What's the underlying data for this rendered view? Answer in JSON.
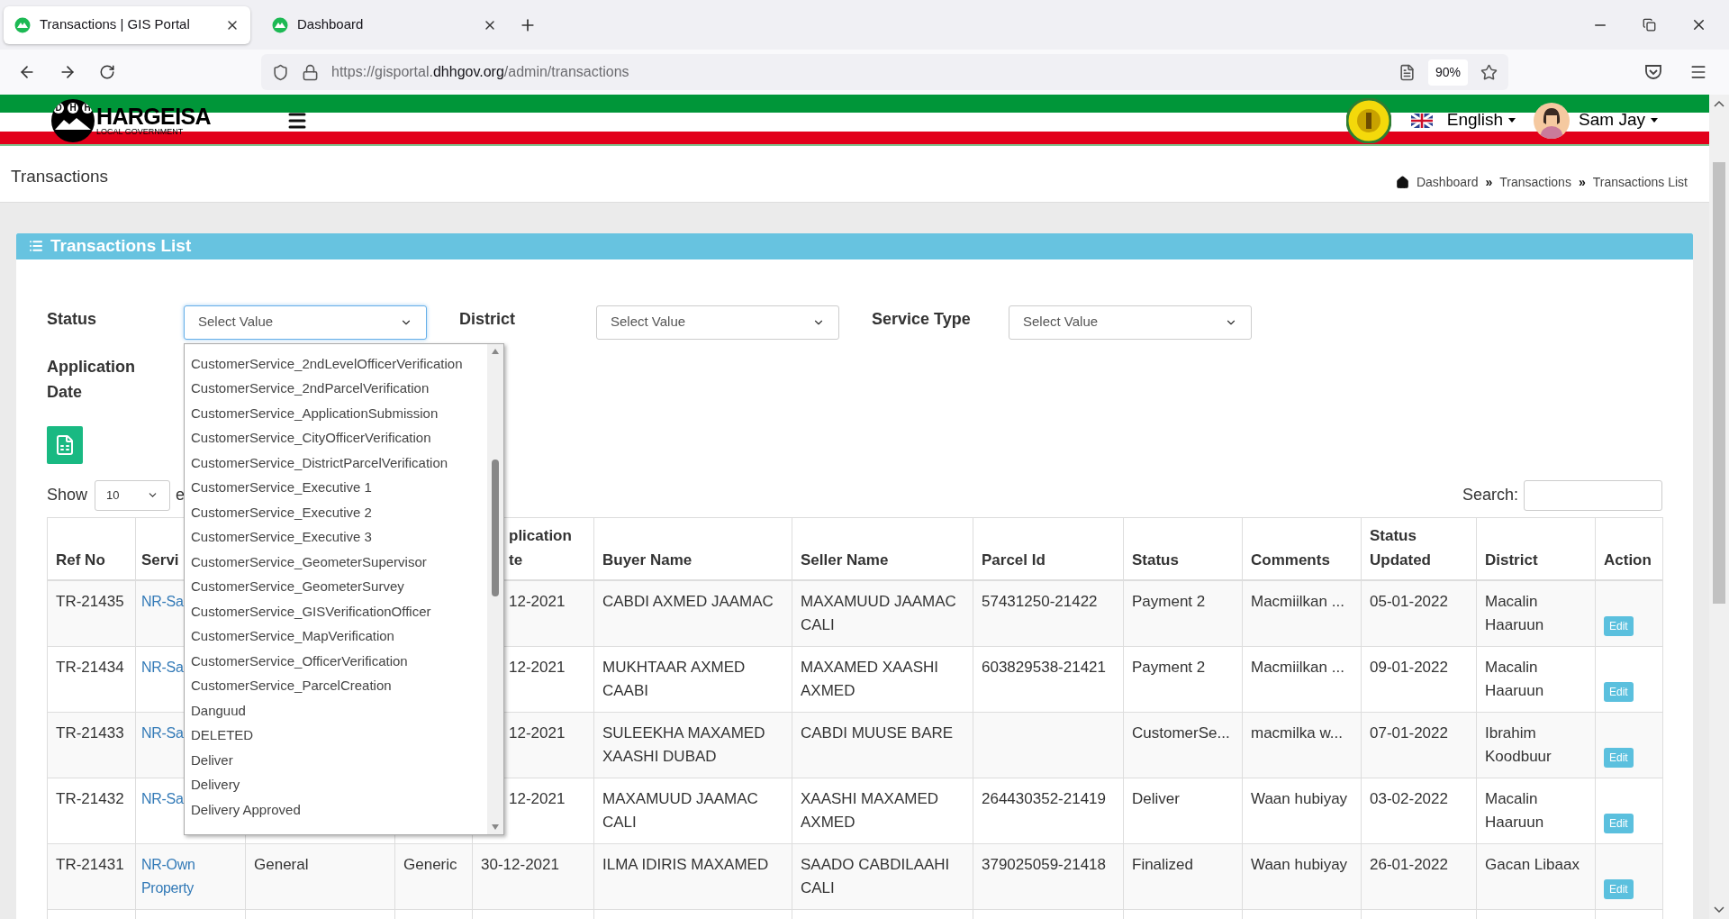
{
  "browser": {
    "tabs": [
      {
        "title": "Transactions | GIS Portal",
        "selected": true
      },
      {
        "title": "Dashboard",
        "selected": false
      }
    ],
    "url": {
      "prefix": "https://gisportal.",
      "domain": "dhhgov.org",
      "path": "/admin/transactions"
    },
    "zoom": "90%"
  },
  "header": {
    "logo": {
      "letters": [
        "D",
        "H",
        "H"
      ],
      "title": "HARGEISA",
      "subtitle": "LOCAL GOVERNMENT"
    },
    "language": "English",
    "user": "Sam Jay"
  },
  "page_title": "Transactions",
  "breadcrumb": {
    "items": [
      "Dashboard",
      "Transactions",
      "Transactions List"
    ],
    "separator": "»"
  },
  "card": {
    "title": "Transactions List",
    "filters": [
      {
        "label": "Status",
        "value": "Select Value",
        "open": true
      },
      {
        "label": "District",
        "value": "Select Value",
        "open": false
      },
      {
        "label": "Service Type",
        "value": "Select Value",
        "open": false
      }
    ],
    "status_options": [
      "CustomerService_2ndLevelOfficerVerification",
      "CustomerService_2ndParcelVerification",
      "CustomerService_ApplicationSubmission",
      "CustomerService_CityOfficerVerification",
      "CustomerService_DistrictParcelVerification",
      "CustomerService_Executive 1",
      "CustomerService_Executive 2",
      "CustomerService_Executive 3",
      "CustomerService_GeometerSupervisor",
      "CustomerService_GeometerSurvey",
      "CustomerService_GISVerificationOfficer",
      "CustomerService_MapVerification",
      "CustomerService_OfficerVerification",
      "CustomerService_ParcelCreation",
      "Danguud",
      "DELETED",
      "Deliver",
      "Delivery",
      "Delivery Approved"
    ],
    "date_filter_label": "Application Date",
    "length": {
      "label": "Show",
      "value": "10",
      "suffix": "e"
    },
    "search_label": "Search:",
    "table": {
      "columns_under_menu": true,
      "columns": {
        "ref_no": "Ref No",
        "service": "Servi",
        "application_date": [
          "plication",
          "te"
        ],
        "buyer_name": "Buyer Name",
        "seller_name": "Seller Name",
        "parcel_id": "Parcel Id",
        "status": "Status",
        "comments": "Comments",
        "status_updated": [
          "Status",
          "Updated"
        ],
        "district": "District",
        "action": "Action"
      },
      "rows": [
        {
          "under_menu": true,
          "ref_no": "TR-21435",
          "service": "NR-Sa",
          "application_date": "12-2021",
          "buyer_name": "CABDI AXMED JAAMAC",
          "seller_name": "MAXAMUUD JAAMAC CALI",
          "parcel_id": "57431250-21422",
          "status": "Payment 2",
          "comments": "Macmiilkan ...",
          "status_updated": "05-01-2022",
          "district": "Macalin Haaruun",
          "action": "Edit"
        },
        {
          "under_menu": true,
          "ref_no": "TR-21434",
          "service": "NR-Sa",
          "application_date": "12-2021",
          "buyer_name": "MUKHTAAR AXMED CAABI",
          "seller_name": "MAXAMED XAASHI AXMED",
          "parcel_id": "603829538-21421",
          "status": "Payment 2",
          "comments": "Macmiilkan ...",
          "status_updated": "09-01-2022",
          "district": "Macalin Haaruun",
          "action": "Edit"
        },
        {
          "under_menu": true,
          "ref_no": "TR-21433",
          "service": "NR-Sa",
          "application_date": "12-2021",
          "buyer_name": "SULEEKHA MAXAMED XAASHI DUBAD",
          "seller_name": "CABDI MUUSE BARE",
          "status": "CustomerSe...",
          "comments": "macmilka w...",
          "status_updated": "07-01-2022",
          "district": "Ibrahim Koodbuur",
          "action": "Edit"
        },
        {
          "under_menu": true,
          "ref_no": "TR-21432",
          "service": "NR-Sa",
          "application_date": "12-2021",
          "buyer_name": "MAXAMUUD JAAMAC CALI",
          "seller_name": "XAASHI MAXAMED AXMED",
          "parcel_id": "264430352-21419",
          "status": "Deliver",
          "comments": "Waan hubiyay",
          "status_updated": "03-02-2022",
          "district": "Macalin Haaruun",
          "action": "Edit"
        },
        {
          "under_menu": false,
          "ref_no": "TR-21431",
          "service": "NR-Own Property",
          "column_3": "General",
          "column_4": "Generic",
          "application_date": "30-12-2021",
          "buyer_name": "ILMA IDIRIS MAXAMED",
          "seller_name": "SAADO CABDILAAHI CALI",
          "parcel_id": "379025059-21418",
          "status": "Finalized",
          "comments": "Waan hubiyay",
          "status_updated": "26-01-2022",
          "district": "Gacan Libaax",
          "action": "Edit"
        }
      ]
    }
  }
}
